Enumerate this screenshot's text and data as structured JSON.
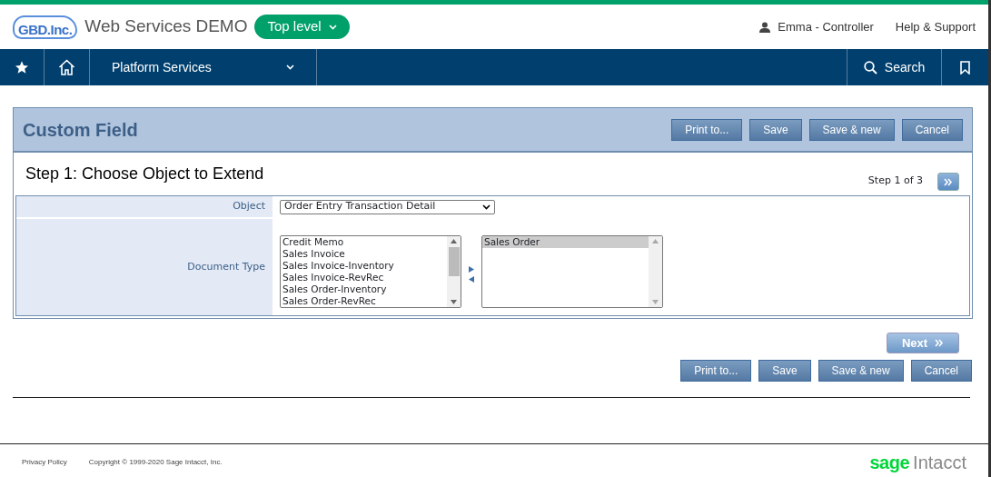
{
  "header": {
    "logo": "GBD.Inc.",
    "app_title": "Web Services DEMO",
    "level_button": "Top level",
    "user": "Emma - Controller",
    "help": "Help & Support"
  },
  "nav": {
    "module": "Platform Services",
    "search": "Search"
  },
  "panel": {
    "title": "Custom Field",
    "top_buttons": [
      "Print to...",
      "Save",
      "Save & new",
      "Cancel"
    ],
    "step_title": "Step 1: Choose Object to Extend",
    "step_counter": "Step 1 of 3",
    "object_label": "Object",
    "object_value": "Order Entry Transaction Detail",
    "doc_type_label": "Document Type",
    "available": [
      {
        "label": "Credit Memo",
        "selected": false
      },
      {
        "label": "Sales Invoice",
        "selected": false
      },
      {
        "label": "Sales Invoice-Inventory",
        "selected": false
      },
      {
        "label": "Sales Invoice-RevRec",
        "selected": false
      },
      {
        "label": "Sales Order-Inventory",
        "selected": false
      },
      {
        "label": "Sales Order-RevRec",
        "selected": false
      }
    ],
    "chosen": [
      {
        "label": "Sales Order",
        "selected": true
      }
    ]
  },
  "next_button": "Next",
  "bottom_buttons": [
    "Print to...",
    "Save",
    "Save & new",
    "Cancel"
  ],
  "footer": {
    "privacy": "Privacy Policy",
    "copyright": "Copyright © 1999-2020 Sage Intacct, Inc.",
    "brand_first": "sage",
    "brand_second": "Intacct"
  }
}
